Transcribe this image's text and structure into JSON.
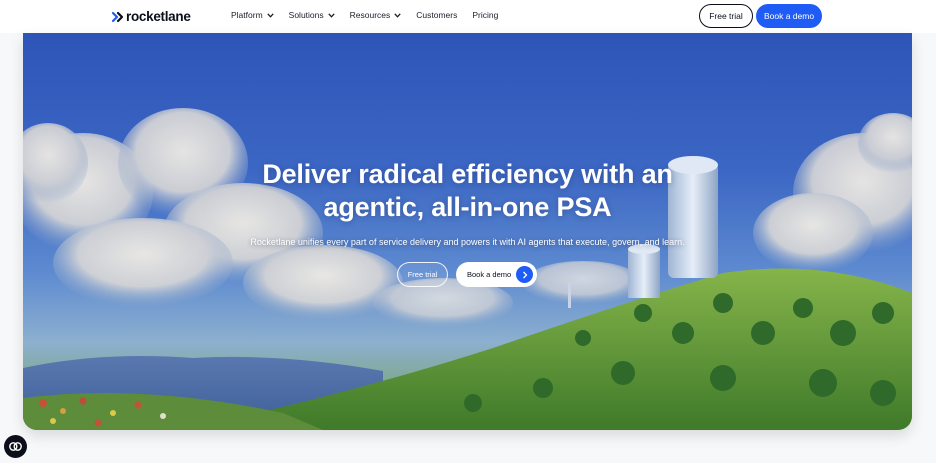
{
  "nav": {
    "logo_text": "rocketlane",
    "items": [
      {
        "label": "Platform",
        "has_dropdown": true
      },
      {
        "label": "Solutions",
        "has_dropdown": true
      },
      {
        "label": "Resources",
        "has_dropdown": true
      },
      {
        "label": "Customers",
        "has_dropdown": false
      },
      {
        "label": "Pricing",
        "has_dropdown": false
      }
    ],
    "free_trial_label": "Free trial",
    "book_demo_label": "Book a demo"
  },
  "hero": {
    "title_line1": "Deliver radical efficiency with an",
    "title_line2": "agentic, all-in-one PSA",
    "subtitle": "Rocketlane unifies every part of service delivery and powers it with AI agents that execute, govern, and learn.",
    "free_trial_label": "Free trial",
    "book_demo_label": "Book a demo"
  },
  "colors": {
    "accent": "#1f5cf5",
    "nav_text": "#1a1f2b",
    "dark": "#0b0f1a"
  },
  "icons": {
    "logo": "double-chevron-logo-icon",
    "dropdown": "chevron-down-icon",
    "demo_arrow": "chevron-right-icon",
    "floating_widget": "link-chat-icon"
  }
}
